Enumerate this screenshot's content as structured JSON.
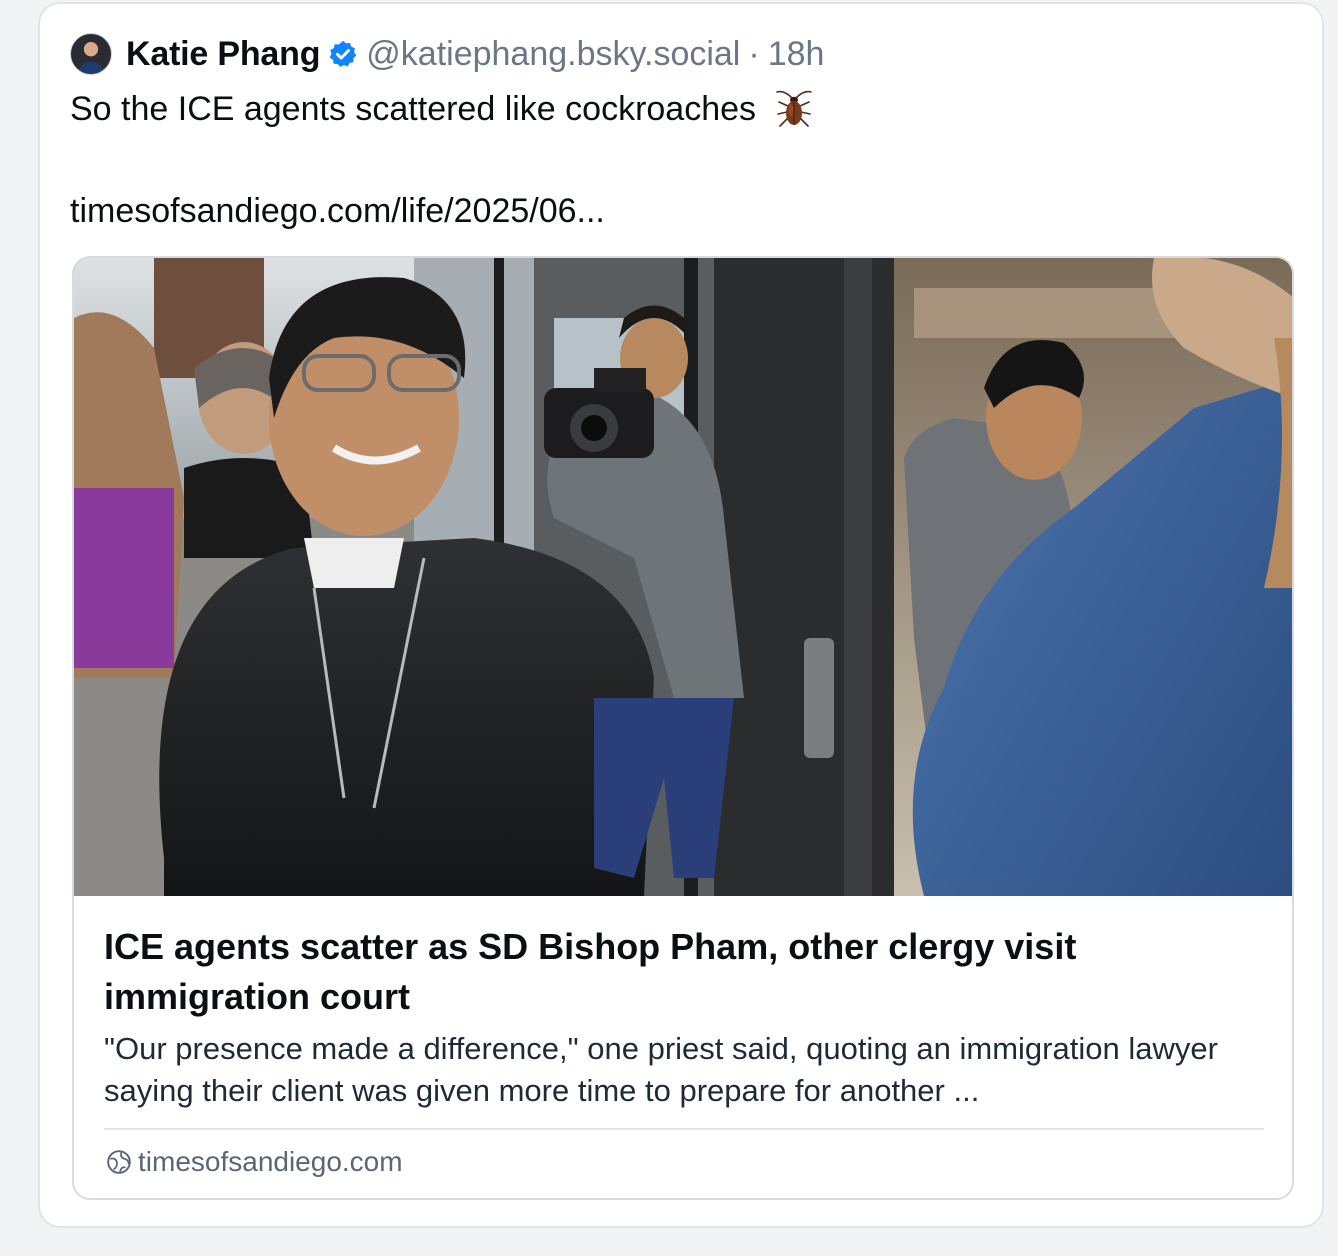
{
  "post": {
    "author": {
      "display_name": "Katie Phang",
      "handle": "@katiephang.bsky.social",
      "verified": true,
      "avatar_icon": "avatar-photo"
    },
    "separator": "·",
    "timestamp": "18h",
    "text": "So the ICE agents scattered like cockroaches",
    "emoji_icon": "cockroach-icon",
    "link_text": "timesofsandiego.com/life/2025/06...",
    "embed": {
      "title": "ICE agents scatter as SD Bishop Pham, other clergy visit immigration court",
      "description": "\"Our presence made a difference,\" one priest said, quoting an immigration lawyer saying their client was given more time to prepare for another ...",
      "domain": "timesofsandiego.com",
      "domain_icon": "globe-icon"
    }
  },
  "colors": {
    "text_primary": "#0b0f14",
    "text_secondary": "#6b7785",
    "verified_blue": "#1083fe",
    "border": "#e1e4e8"
  }
}
